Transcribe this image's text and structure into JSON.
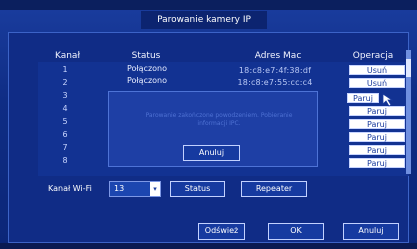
{
  "window": {
    "title": "Parowanie kamery IP"
  },
  "table": {
    "headers": {
      "channel": "Kanał",
      "status": "Status",
      "mac": "Adres Mac",
      "operation": "Operacja"
    },
    "rows": [
      {
        "channel": "1",
        "status": "Połączono",
        "mac": "18:c8:e7:4f:38:df",
        "action": "Usuń"
      },
      {
        "channel": "2",
        "status": "Połączono",
        "mac": "18:c8:e7:55:cc:c4",
        "action": "Usuń"
      },
      {
        "channel": "3",
        "status": "",
        "mac": "",
        "action": "Paruj"
      },
      {
        "channel": "4",
        "status": "",
        "mac": "",
        "action": "Paruj"
      },
      {
        "channel": "5",
        "status": "",
        "mac": "",
        "action": "Paruj"
      },
      {
        "channel": "6",
        "status": "",
        "mac": "",
        "action": "Paruj"
      },
      {
        "channel": "7",
        "status": "",
        "mac": "",
        "action": "Paruj"
      },
      {
        "channel": "8",
        "status": "",
        "mac": "",
        "action": "Paruj"
      }
    ]
  },
  "dialog": {
    "message": "Parowanie zakończone powodzeniem. Pobieranie informacji IPC.",
    "button": "Anuluj"
  },
  "wifi": {
    "label": "Kanał Wi-Fi",
    "selected": "13",
    "status_button": "Status",
    "repeater_button": "Repeater"
  },
  "footer": {
    "refresh": "Odśwież",
    "ok": "OK",
    "cancel": "Anuluj"
  },
  "colors": {
    "background": "#0f2d85",
    "button_light": "#ffffff",
    "button_text_dark": "#1b3c9e",
    "accent_border": "#c2d1ff"
  },
  "icons": [
    "cursor-arrow-icon",
    "dropdown-arrow-icon"
  ]
}
